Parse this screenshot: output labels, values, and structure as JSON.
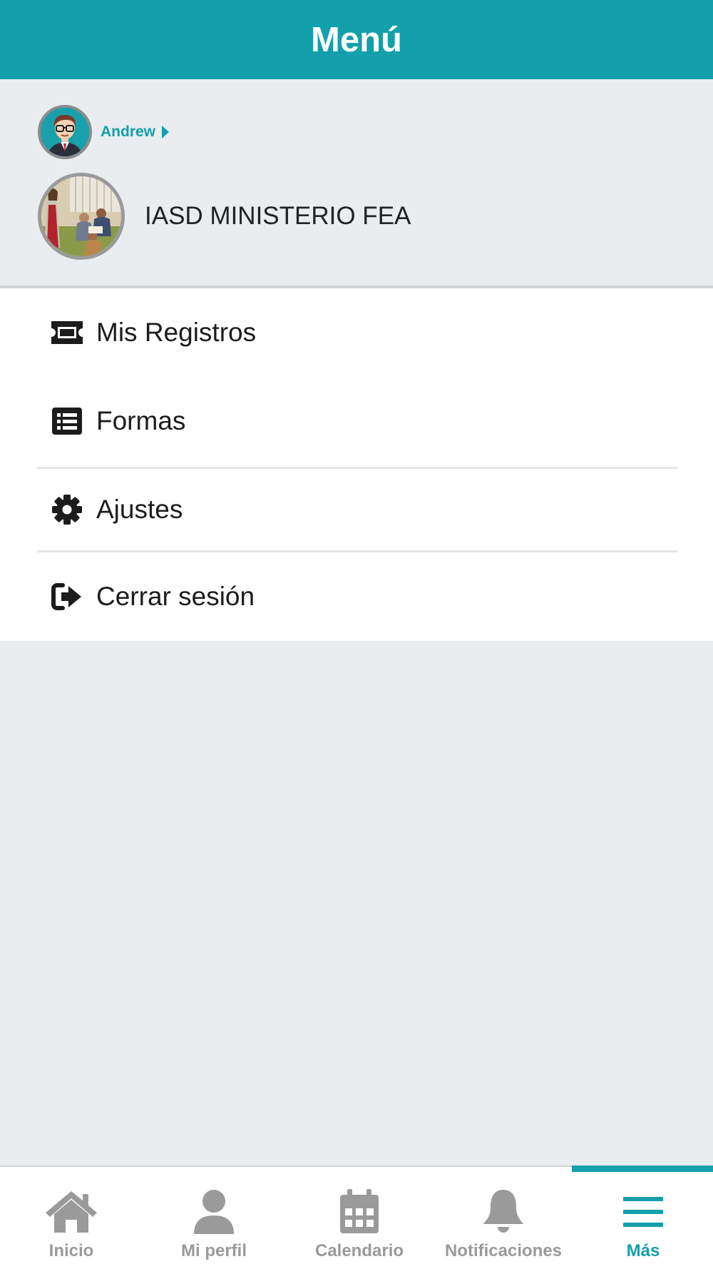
{
  "header": {
    "title": "Menú"
  },
  "profile": {
    "user": {
      "name": "Andrew",
      "avatar_icon": "user-avatar-cartoon",
      "caret_icon": "caret-right-icon"
    },
    "organization": {
      "name": "IASD MINISTERIO FEA",
      "avatar_icon": "organization-avatar-image"
    }
  },
  "menu": {
    "items": [
      {
        "id": "mis-registros",
        "label": "Mis Registros",
        "icon": "ticket-icon"
      },
      {
        "id": "formas",
        "label": "Formas",
        "icon": "list-icon"
      },
      {
        "id": "ajustes",
        "label": "Ajustes",
        "icon": "gear-icon"
      },
      {
        "id": "cerrar-sesion",
        "label": "Cerrar sesión",
        "icon": "sign-out-icon"
      }
    ]
  },
  "tabbar": {
    "tabs": [
      {
        "id": "inicio",
        "label": "Inicio",
        "icon": "home-icon",
        "active": false
      },
      {
        "id": "mi-perfil",
        "label": "Mi perfil",
        "icon": "user-icon",
        "active": false
      },
      {
        "id": "calendario",
        "label": "Calendario",
        "icon": "calendar-icon",
        "active": false
      },
      {
        "id": "notificaciones",
        "label": "Notificaciones",
        "icon": "bell-icon",
        "active": false
      },
      {
        "id": "mas",
        "label": "Más",
        "icon": "menu-bars-icon",
        "active": true
      }
    ]
  },
  "colors": {
    "primary": "#139fab",
    "background": "#e9edef",
    "menu_background": "#ffffff",
    "text": "#1c1c1c",
    "inactive_tab": "#9a9a9a"
  }
}
